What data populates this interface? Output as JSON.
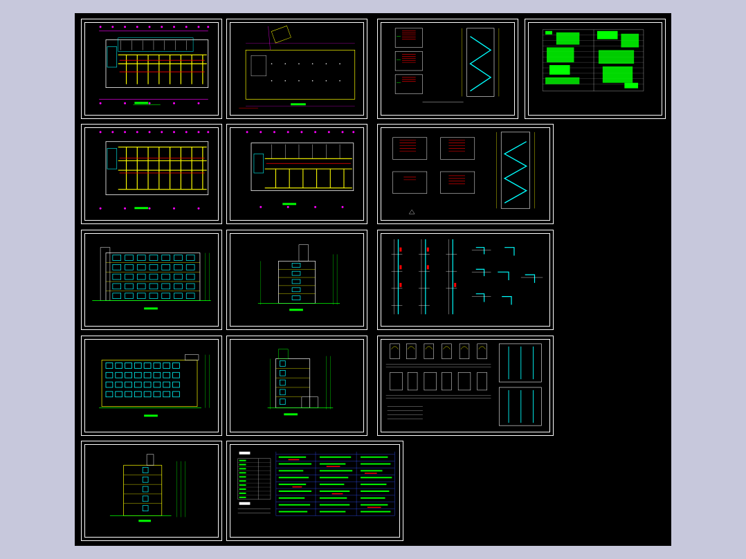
{
  "app": {
    "title": "",
    "canvas_background": "#000000",
    "window_background": "#c7c8dc"
  },
  "colors": {
    "white": "#ffffff",
    "yellow": "#ffff00",
    "cyan": "#00ffff",
    "red": "#ff0000",
    "magenta": "#ff00ff",
    "green": "#00ff00",
    "blue": "#3050ff"
  },
  "sheets": [
    {
      "id": "floor-plan-1",
      "kind": "plan"
    },
    {
      "id": "site-plan",
      "kind": "site"
    },
    {
      "id": "stair-detail-1",
      "kind": "stair"
    },
    {
      "id": "schedule-table",
      "kind": "table"
    },
    {
      "id": "floor-plan-2",
      "kind": "plan"
    },
    {
      "id": "floor-plan-3",
      "kind": "plan"
    },
    {
      "id": "stair-detail-2",
      "kind": "stair"
    },
    {
      "id": "front-elevation",
      "kind": "elevation"
    },
    {
      "id": "side-elevation-1",
      "kind": "elevation"
    },
    {
      "id": "wall-sections",
      "kind": "sections"
    },
    {
      "id": "rear-elevation",
      "kind": "elevation"
    },
    {
      "id": "side-elevation-2",
      "kind": "elevation"
    },
    {
      "id": "door-window-details",
      "kind": "details"
    },
    {
      "id": "side-elevation-3",
      "kind": "elevation"
    },
    {
      "id": "design-notes",
      "kind": "notes"
    }
  ]
}
